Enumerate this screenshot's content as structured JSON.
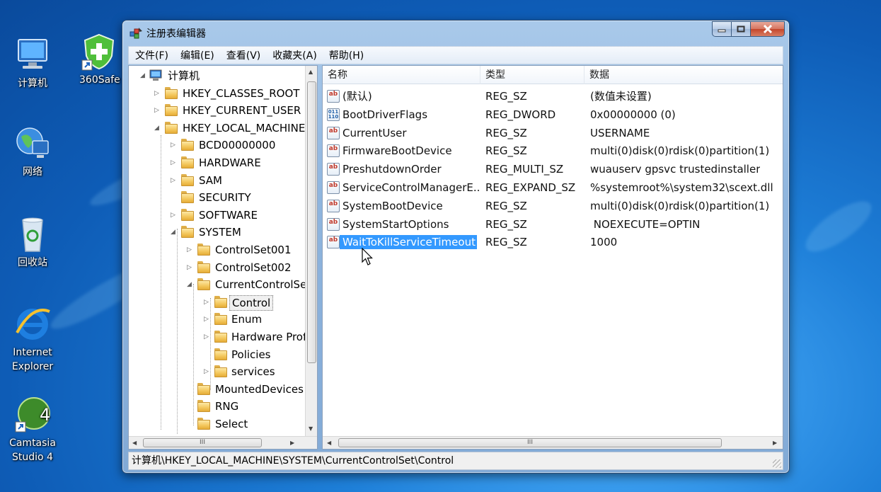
{
  "desktop": {
    "icons": [
      {
        "label": "计算机",
        "icon": "computer-icon"
      },
      {
        "label": "360Safe",
        "icon": "360safe-icon"
      },
      {
        "label": "网络",
        "icon": "network-icon"
      },
      {
        "label": "回收站",
        "icon": "recycle-bin-icon"
      },
      {
        "label": "Internet",
        "label2": "Explorer",
        "icon": "internet-explorer-icon"
      },
      {
        "label": "Camtasia",
        "label2": "Studio 4",
        "icon": "camtasia-icon"
      }
    ]
  },
  "window": {
    "title": "注册表编辑器",
    "controls": {
      "minimize": "minimize",
      "maximize": "maximize",
      "close": "close"
    }
  },
  "menu": [
    "文件(F)",
    "编辑(E)",
    "查看(V)",
    "收藏夹(A)",
    "帮助(H)"
  ],
  "tree": {
    "items": [
      {
        "label": "计算机",
        "expander": "◢",
        "selected": false
      },
      {
        "label": "HKEY_CLASSES_ROOT",
        "expander": "▷",
        "selected": false
      },
      {
        "label": "HKEY_CURRENT_USER",
        "expander": "▷",
        "selected": false
      },
      {
        "label": "HKEY_LOCAL_MACHINE",
        "expander": "◢",
        "selected": false
      },
      {
        "label": "BCD00000000",
        "expander": "▷",
        "selected": false
      },
      {
        "label": "HARDWARE",
        "expander": "▷",
        "selected": false
      },
      {
        "label": "SAM",
        "expander": "▷",
        "selected": false
      },
      {
        "label": "SECURITY",
        "expander": "",
        "selected": false
      },
      {
        "label": "SOFTWARE",
        "expander": "▷",
        "selected": false
      },
      {
        "label": "SYSTEM",
        "expander": "◢",
        "selected": false
      },
      {
        "label": "ControlSet001",
        "expander": "▷",
        "selected": false
      },
      {
        "label": "ControlSet002",
        "expander": "▷",
        "selected": false
      },
      {
        "label": "CurrentControlSet",
        "expander": "◢",
        "selected": false
      },
      {
        "label": "Control",
        "expander": "▷",
        "selected": true
      },
      {
        "label": "Enum",
        "expander": "▷",
        "selected": false
      },
      {
        "label": "Hardware Profiles",
        "expander": "▷",
        "selected": false
      },
      {
        "label": "Policies",
        "expander": "",
        "selected": false
      },
      {
        "label": "services",
        "expander": "▷",
        "selected": false
      },
      {
        "label": "MountedDevices",
        "expander": "",
        "selected": false
      },
      {
        "label": "RNG",
        "expander": "",
        "selected": false
      },
      {
        "label": "Select",
        "expander": "",
        "selected": false
      }
    ],
    "scroll_thumb_label": "III"
  },
  "list": {
    "columns": [
      "名称",
      "类型",
      "数据"
    ],
    "rows": [
      {
        "name": "(默认)",
        "type": "REG_SZ",
        "data": "(数值未设置)",
        "icon": "ab"
      },
      {
        "name": "BootDriverFlags",
        "type": "REG_DWORD",
        "data": "0x00000000 (0)",
        "icon": "bin"
      },
      {
        "name": "CurrentUser",
        "type": "REG_SZ",
        "data": "USERNAME",
        "icon": "ab"
      },
      {
        "name": "FirmwareBootDevice",
        "type": "REG_SZ",
        "data": "multi(0)disk(0)rdisk(0)partition(1)",
        "icon": "ab"
      },
      {
        "name": "PreshutdownOrder",
        "type": "REG_MULTI_SZ",
        "data": "wuauserv gpsvc trustedinstaller",
        "icon": "ab"
      },
      {
        "name": "ServiceControlManagerE...",
        "type": "REG_EXPAND_SZ",
        "data": "%systemroot%\\system32\\scext.dll",
        "icon": "ab"
      },
      {
        "name": "SystemBootDevice",
        "type": "REG_SZ",
        "data": "multi(0)disk(0)rdisk(0)partition(1)",
        "icon": "ab"
      },
      {
        "name": "SystemStartOptions",
        "type": "REG_SZ",
        "data": " NOEXECUTE=OPTIN",
        "icon": "ab"
      },
      {
        "name": "WaitToKillServiceTimeout",
        "type": "REG_SZ",
        "data": "1000",
        "icon": "ab",
        "selected": true
      }
    ],
    "scroll_thumb_label": "III"
  },
  "status": {
    "path": "计算机\\HKEY_LOCAL_MACHINE\\SYSTEM\\CurrentControlSet\\Control"
  },
  "colors": {
    "selection": "#3399ff",
    "window_frame": "#8fb5de",
    "desktop": "#1e7fd8"
  }
}
